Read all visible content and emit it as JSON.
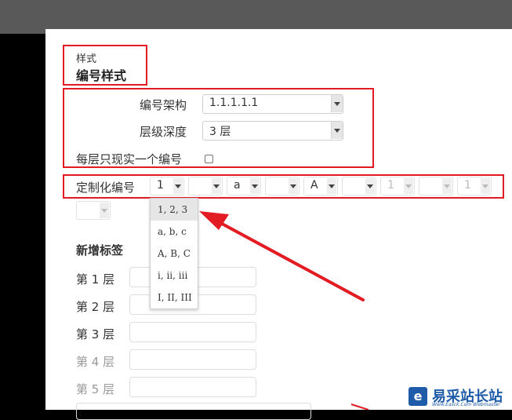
{
  "style_section": {
    "small_label": "样式",
    "title": "编号样式"
  },
  "numbering": {
    "arch_label": "编号架构",
    "arch_value": "1.1.1.1.1",
    "depth_label": "层级深度",
    "depth_value": "3 层",
    "single_label": "每层只现实一个编号"
  },
  "custom": {
    "label": "定制化编号",
    "selects": [
      "1",
      "",
      "a",
      "",
      "A",
      "",
      "1",
      "",
      "1",
      ""
    ]
  },
  "dropdown": {
    "options": [
      "1, 2, 3",
      "a, b, c",
      "A, B, C",
      "i, ii, iii",
      "I, II, III"
    ],
    "selected_index": 0
  },
  "tags": {
    "title": "新增标签",
    "levels": [
      "第 1 层",
      "第 2 层",
      "第 3 层",
      "第 4 层",
      "第 5 层"
    ]
  },
  "logo": {
    "mark": "e",
    "name": "易采站长站",
    "sub": "Www.Easck.Com Webmaster"
  },
  "colors": {
    "highlight": "#e31b23",
    "logo": "#1e5ba8"
  }
}
